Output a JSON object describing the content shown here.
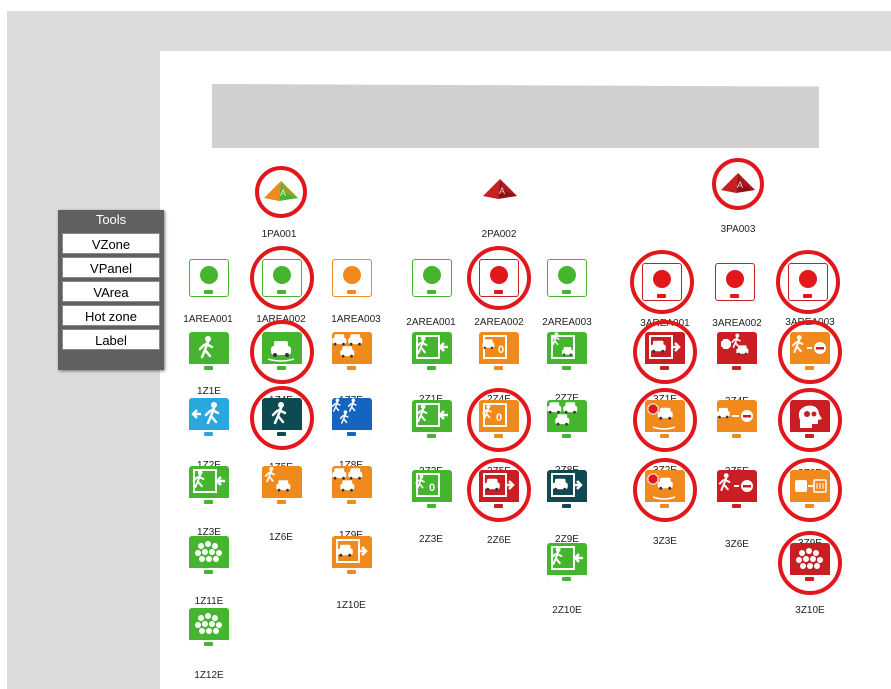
{
  "tools": {
    "title": "Tools",
    "buttons": [
      "VZone",
      "VPanel",
      "VArea",
      "Hot zone",
      "Label"
    ]
  },
  "parking_areas": [
    {
      "label": "1PA001",
      "color": "#f08a1c",
      "accent": "#45b52f",
      "highlighted": true
    },
    {
      "label": "2PA002",
      "color": "#c91f24",
      "accent": "#8c1015",
      "highlighted": false
    },
    {
      "label": "3PA003",
      "color": "#c91f24",
      "accent": "#8c1015",
      "highlighted": true
    }
  ],
  "areas": [
    {
      "label": "1AREA001",
      "status": "green",
      "highlighted": false
    },
    {
      "label": "1AREA002",
      "status": "green",
      "highlighted": true
    },
    {
      "label": "1AREA003",
      "status": "orange",
      "highlighted": false
    },
    {
      "label": "2AREA001",
      "status": "green",
      "highlighted": false
    },
    {
      "label": "2AREA002",
      "status": "red",
      "highlighted": true
    },
    {
      "label": "2AREA003",
      "status": "green",
      "highlighted": false
    },
    {
      "label": "3AREA001",
      "status": "red",
      "highlighted": true
    },
    {
      "label": "3AREA002",
      "status": "red",
      "highlighted": false
    },
    {
      "label": "3AREA003",
      "status": "red",
      "highlighted": true
    }
  ],
  "zones": [
    {
      "label": "1Z1E",
      "color": "#45b52f",
      "symbol": "walk",
      "highlighted": false
    },
    {
      "label": "1Z4E",
      "color": "#45b52f",
      "symbol": "car",
      "highlighted": true
    },
    {
      "label": "1Z7E",
      "color": "#f08a1c",
      "symbol": "cars",
      "highlighted": false
    },
    {
      "label": "1Z2E",
      "color": "#29a8e0",
      "symbol": "walk-left",
      "highlighted": false
    },
    {
      "label": "1Z5E",
      "color": "#0f4a52",
      "symbol": "walk",
      "highlighted": true
    },
    {
      "label": "1Z8E",
      "color": "#1565c0",
      "symbol": "people",
      "highlighted": false
    },
    {
      "label": "1Z3E",
      "color": "#45b52f",
      "symbol": "exit",
      "highlighted": false
    },
    {
      "label": "1Z6E",
      "color": "#f08a1c",
      "symbol": "walk-car",
      "highlighted": false
    },
    {
      "label": "1Z9E",
      "color": "#f08a1c",
      "symbol": "cars",
      "highlighted": false
    },
    {
      "label": "1Z11E",
      "color": "#45b52f",
      "symbol": "crowd",
      "highlighted": false
    },
    {
      "label": "1Z10E",
      "color": "#f08a1c",
      "symbol": "car-exit",
      "highlighted": false
    },
    {
      "label": "1Z12E",
      "color": "#45b52f",
      "symbol": "crowd",
      "highlighted": false
    },
    {
      "label": "2Z1E",
      "color": "#45b52f",
      "symbol": "exit",
      "highlighted": false
    },
    {
      "label": "2Z4E",
      "color": "#f08a1c",
      "symbol": "car-zero",
      "highlighted": false
    },
    {
      "label": "2Z7E",
      "color": "#45b52f",
      "symbol": "exit-car",
      "highlighted": false
    },
    {
      "label": "2Z2E",
      "color": "#45b52f",
      "symbol": "exit",
      "highlighted": false
    },
    {
      "label": "2Z5E",
      "color": "#f08a1c",
      "symbol": "walk-zero",
      "highlighted": true
    },
    {
      "label": "2Z8E",
      "color": "#45b52f",
      "symbol": "cars",
      "highlighted": false
    },
    {
      "label": "2Z3E",
      "color": "#45b52f",
      "symbol": "walk-zero",
      "highlighted": false
    },
    {
      "label": "2Z6E",
      "color": "#c91f24",
      "symbol": "car-exit",
      "highlighted": true
    },
    {
      "label": "2Z9E",
      "color": "#0f4a52",
      "symbol": "car-exit",
      "highlighted": false
    },
    {
      "label": "2Z10E",
      "color": "#45b52f",
      "symbol": "exit",
      "highlighted": false
    },
    {
      "label": "3Z1E",
      "color": "#c91f24",
      "symbol": "car-exit",
      "highlighted": true
    },
    {
      "label": "3Z4E",
      "color": "#c91f24",
      "symbol": "stop-walk",
      "highlighted": false
    },
    {
      "label": "3Z7E",
      "color": "#f08a1c",
      "symbol": "walk-noentry",
      "highlighted": true
    },
    {
      "label": "3Z2E",
      "color": "#f08a1c",
      "symbol": "stop-car",
      "highlighted": true
    },
    {
      "label": "3Z5E",
      "color": "#f08a1c",
      "symbol": "car-noentry",
      "highlighted": false
    },
    {
      "label": "3Z8E",
      "color": "#c91f24",
      "symbol": "head",
      "highlighted": true
    },
    {
      "label": "3Z3E",
      "color": "#f08a1c",
      "symbol": "stop-car",
      "highlighted": true
    },
    {
      "label": "3Z6E",
      "color": "#c91f24",
      "symbol": "walk-noentry",
      "highlighted": false
    },
    {
      "label": "3Z9E",
      "color": "#f08a1c",
      "symbol": "bus",
      "highlighted": true
    },
    {
      "label": "3Z10E",
      "color": "#c91f24",
      "symbol": "crowd",
      "highlighted": true
    }
  ]
}
